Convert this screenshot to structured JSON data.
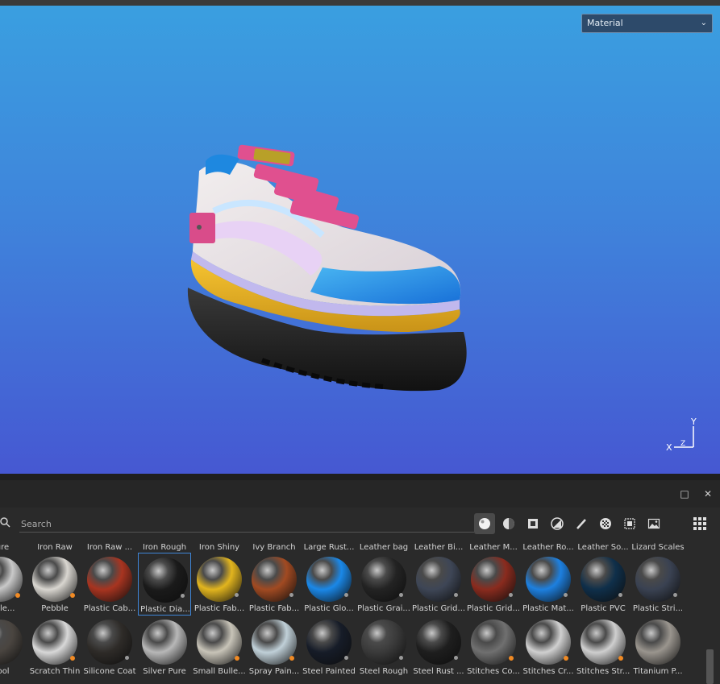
{
  "viewport": {
    "mode_select": {
      "value": "Material"
    },
    "axis": {
      "x": "X",
      "y": "Y",
      "z": "Z"
    }
  },
  "panel": {
    "search": {
      "placeholder": "Search"
    },
    "filters": [
      "material-sphere-icon",
      "smart-material-icon",
      "mask-icon",
      "filter-icon",
      "brush-icon",
      "alpha-icon",
      "texture-icon",
      "environment-icon"
    ],
    "top_row_labels": [
      "Pure",
      "Iron Raw",
      "Iron Raw ...",
      "Iron Rough",
      "Iron Shiny",
      "Ivy Branch",
      "Large Rust...",
      "Leather bag",
      "Leather Bi...",
      "Leather M...",
      "Leather Ro...",
      "Leather So...",
      "Lizard Scales"
    ],
    "row1": [
      {
        "label": "...olle...",
        "color": "#c9c9c9",
        "dot": "orange"
      },
      {
        "label": "Pebble",
        "color": "#d9d6d0",
        "dot": "orange"
      },
      {
        "label": "Plastic Cab...",
        "color": "#a83420",
        "dot": "none"
      },
      {
        "label": "Plastic Dia...",
        "color": "#1a1a1a",
        "dot": "grey"
      },
      {
        "label": "Plastic Fab...",
        "color": "#e2b51e",
        "dot": "grey"
      },
      {
        "label": "Plastic Fab...",
        "color": "#a14a22",
        "dot": "grey"
      },
      {
        "label": "Plastic Glo...",
        "color": "#1a88e8",
        "dot": "grey"
      },
      {
        "label": "Plastic Grai...",
        "color": "#232323",
        "dot": "grey"
      },
      {
        "label": "Plastic Grid...",
        "color": "#3e4656",
        "dot": "grey"
      },
      {
        "label": "Plastic Grid...",
        "color": "#8a2b1e",
        "dot": "grey"
      },
      {
        "label": "Plastic Mat...",
        "color": "#1d80e0",
        "dot": "grey"
      },
      {
        "label": "Plastic PVC",
        "color": "#0f2f4a",
        "dot": "grey"
      },
      {
        "label": "Plastic Stri...",
        "color": "#3a4252",
        "dot": "grey"
      }
    ],
    "row2": [
      {
        "label": "wool",
        "color": "#4a4540",
        "dot": "none"
      },
      {
        "label": "Scratch Thin",
        "color": "#d8d8d8",
        "dot": "orange"
      },
      {
        "label": "Silicone Coat",
        "color": "#2e2b28",
        "dot": "grey"
      },
      {
        "label": "Silver Pure",
        "color": "#b8b8b8",
        "dot": "none"
      },
      {
        "label": "Small Bulle...",
        "color": "#c8c4b8",
        "dot": "orange"
      },
      {
        "label": "Spray Pain...",
        "color": "#c0d0d8",
        "dot": "orange"
      },
      {
        "label": "Steel Painted",
        "color": "#161c28",
        "dot": "grey"
      },
      {
        "label": "Steel Rough",
        "color": "#3a3a3a",
        "dot": "grey"
      },
      {
        "label": "Steel Rust ...",
        "color": "#1e1e1e",
        "dot": "grey"
      },
      {
        "label": "Stitches Co...",
        "color": "#707070",
        "dot": "orange"
      },
      {
        "label": "Stitches Cr...",
        "color": "#d0d0d0",
        "dot": "orange"
      },
      {
        "label": "Stitches Str...",
        "color": "#cfcfcf",
        "dot": "orange"
      },
      {
        "label": "Titanium P...",
        "color": "#9a958e",
        "dot": "none"
      }
    ]
  },
  "colors": {
    "accent": "#3f86d8",
    "orange_badge": "#f08a24"
  }
}
